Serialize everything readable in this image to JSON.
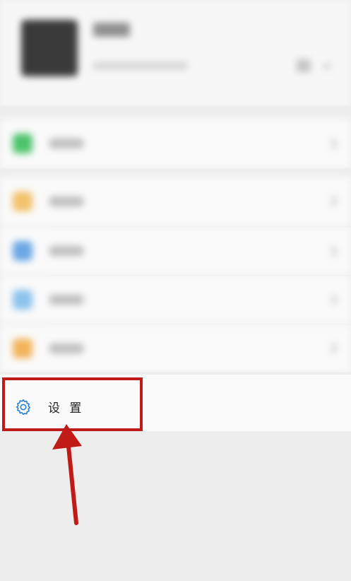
{
  "settings_item": {
    "label": "设 置",
    "icon": "gear-icon"
  },
  "colors": {
    "accent": "#2a7fd5",
    "highlight": "#c01b17",
    "background": "#ededed"
  },
  "menu_icons": [
    "wallet-icon",
    "favorites-icon",
    "album-icon",
    "cards-icon",
    "emoji-icon"
  ]
}
